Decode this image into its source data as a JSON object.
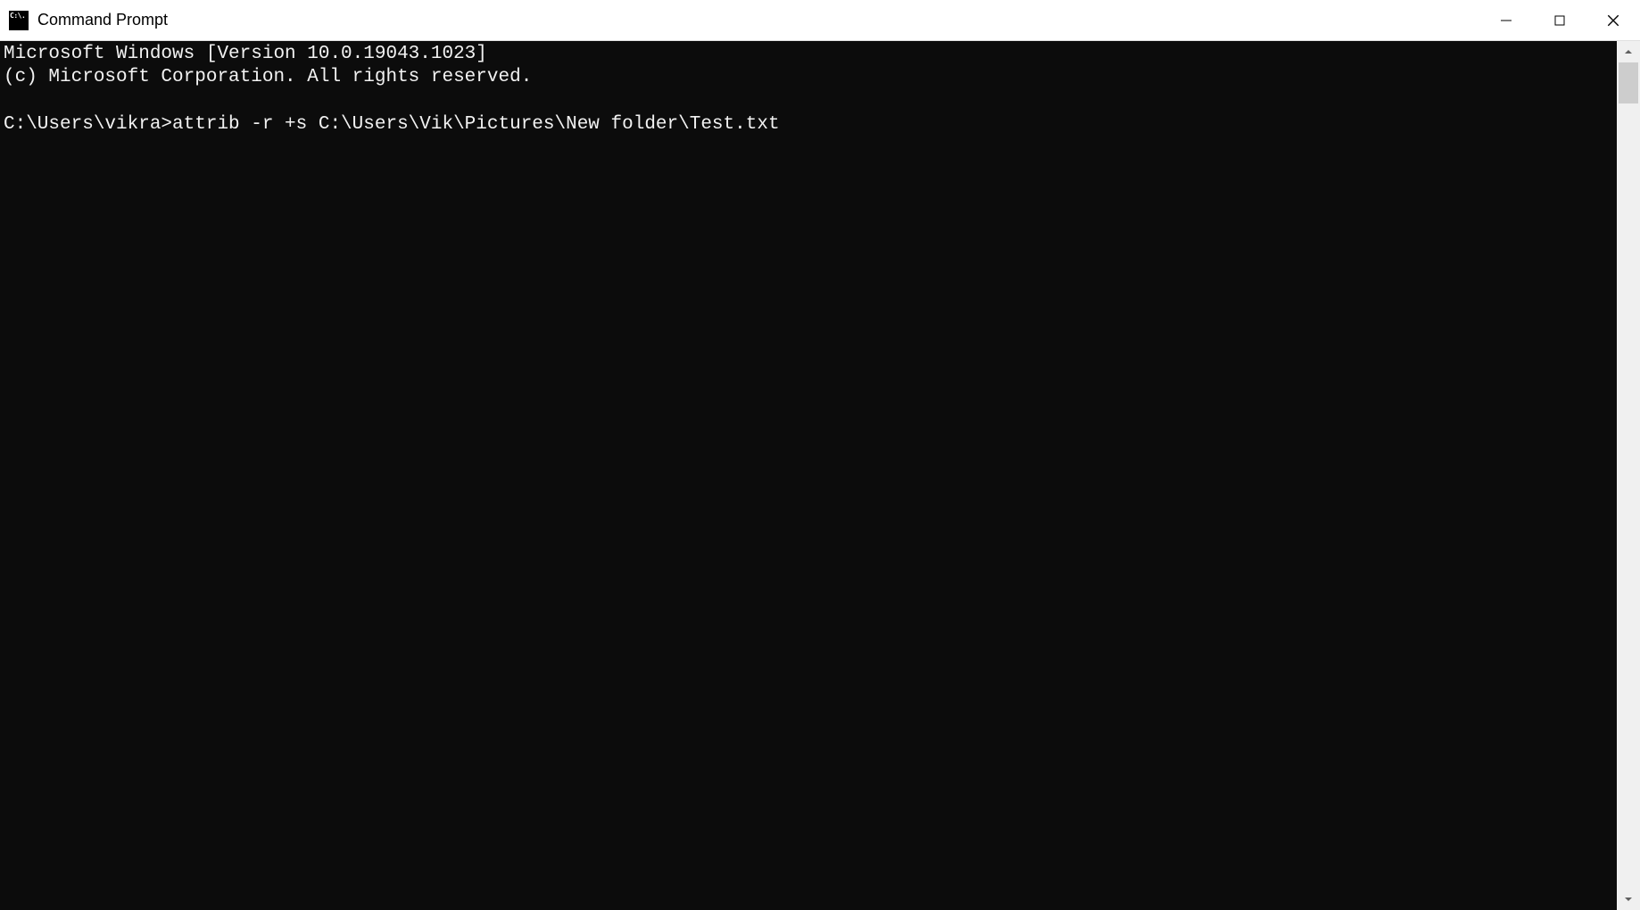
{
  "window": {
    "title": "Command Prompt",
    "icon_name": "cmd-icon"
  },
  "terminal": {
    "lines": [
      "Microsoft Windows [Version 10.0.19043.1023]",
      "(c) Microsoft Corporation. All rights reserved.",
      "",
      "C:\\Users\\vikra>attrib -r +s C:\\Users\\Vik\\Pictures\\New folder\\Test.txt"
    ],
    "prompt": "C:\\Users\\vikra>",
    "command": "attrib -r +s C:\\Users\\Vik\\Pictures\\New folder\\Test.txt"
  },
  "controls": {
    "minimize": "minimize",
    "maximize": "maximize",
    "close": "close"
  }
}
